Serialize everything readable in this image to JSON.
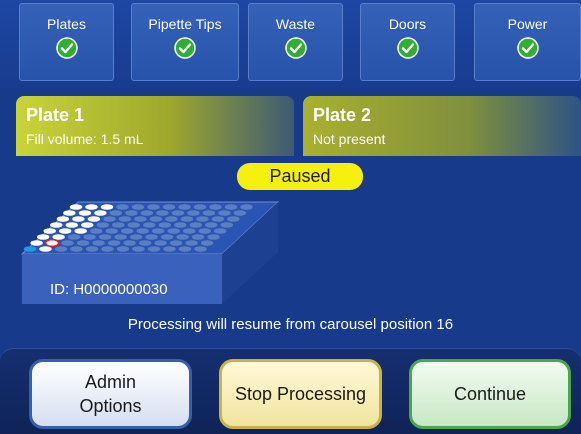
{
  "status_bar": {
    "items": [
      {
        "label": "Plates",
        "icon": "check-icon",
        "state": "ok"
      },
      {
        "label": "Pipette Tips",
        "icon": "check-icon",
        "state": "ok"
      },
      {
        "label": "Waste",
        "icon": "check-icon",
        "state": "ok"
      },
      {
        "label": "Doors",
        "icon": "check-icon",
        "state": "ok"
      },
      {
        "label": "Power",
        "icon": "check-icon",
        "state": "ok"
      }
    ]
  },
  "plates": [
    {
      "name": "Plate 1",
      "status": "Fill volume: 1.5 mL"
    },
    {
      "name": "Plate 2",
      "status": "Not present"
    }
  ],
  "state_badge": "Paused",
  "plate_id": "ID: H0000000030",
  "processing_message": "Processing will resume from carousel position 16",
  "buttons": {
    "admin_line1": "Admin",
    "admin_line2": "Options",
    "stop": "Stop Processing",
    "continue": "Continue"
  },
  "colors": {
    "background": "#183a8a",
    "badge": "#f6f00f",
    "check": "#2fae2f",
    "well_filled": "#ffffff",
    "well_empty": "#5b7fc3",
    "well_current": "#1e9be8",
    "well_marker": "#e02020"
  }
}
